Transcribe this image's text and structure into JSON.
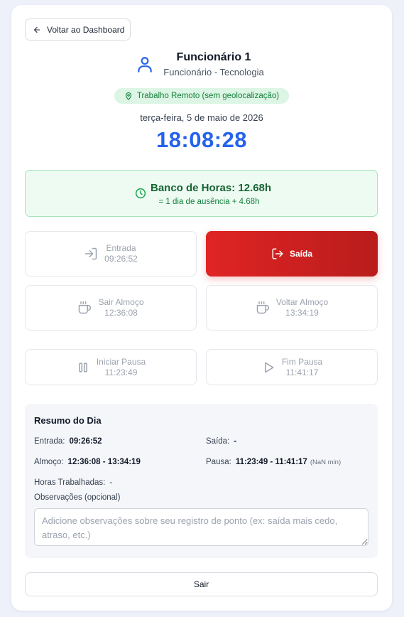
{
  "header": {
    "back_label": "Voltar ao Dashboard"
  },
  "user": {
    "name": "Funcionário 1",
    "role": "Funcionário - Tecnologia",
    "badge": "Trabalho Remoto (sem geolocalização)"
  },
  "clock": {
    "date": "terça-feira, 5 de maio de 2026",
    "time": "18:08:28"
  },
  "bank": {
    "title": "Banco de Horas: 12.68h",
    "subtitle": "= 1 dia de ausência + 4.68h"
  },
  "punches": {
    "entrada": {
      "label": "Entrada",
      "time": "09:26:52"
    },
    "saida": {
      "label": "Saída"
    },
    "sair_almoco": {
      "label": "Sair Almoço",
      "time": "12:36:08"
    },
    "voltar_almoco": {
      "label": "Voltar Almoço",
      "time": "13:34:19"
    },
    "iniciar_pausa": {
      "label": "Iniciar Pausa",
      "time": "11:23:49"
    },
    "fim_pausa": {
      "label": "Fim Pausa",
      "time": "11:41:17"
    }
  },
  "summary": {
    "title": "Resumo do Dia",
    "entrada_label": "Entrada:",
    "entrada_value": "09:26:52",
    "saida_label": "Saída:",
    "saida_value": "-",
    "almoco_label": "Almoço:",
    "almoco_value": "12:36:08 - 13:34:19",
    "pausa_label": "Pausa:",
    "pausa_value": "11:23:49 - 11:41:17",
    "pausa_duration": "(NaN min)",
    "horas_label": "Horas Trabalhadas:",
    "horas_value": "-",
    "obs_label": "Observações (opcional)",
    "obs_placeholder": "Adicione observações sobre seu registro de ponto (ex: saída mais cedo, atraso, etc.)"
  },
  "footer": {
    "logout_label": "Sair"
  },
  "colors": {
    "accent_blue": "#2563eb",
    "exit_red": "#dc2626",
    "success_green": "#15803d"
  },
  "icons": {
    "back": "arrow-left-icon",
    "user": "user-icon",
    "location": "map-pin-icon",
    "clock": "clock-icon",
    "entry": "log-in-icon",
    "exit": "log-out-icon",
    "lunch": "coffee-icon",
    "pause": "pause-icon",
    "play": "play-icon"
  }
}
